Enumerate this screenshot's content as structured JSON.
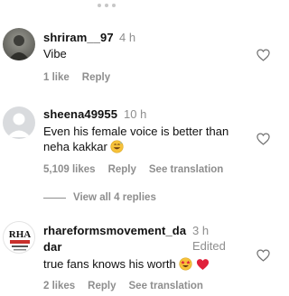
{
  "comments": [
    {
      "username": "shriram__97",
      "time": "4 h",
      "text": "Vibe",
      "likes": "1 like",
      "reply_label": "Reply",
      "avatar_icon": "profile-photo"
    },
    {
      "username": "sheena49955",
      "time": "10 h",
      "text_line1": "Even his female voice is better than",
      "text_line2": "neha kakkar",
      "text_emoji": "grinning-sweat-emoji",
      "likes": "5,109 likes",
      "reply_label": "Reply",
      "translation_label": "See translation",
      "avatar_icon": "default-avatar",
      "view_replies": "View all 4 replies"
    },
    {
      "username_line1": "rhareformsmovement_da",
      "username_line2": "dar",
      "time": "3 h",
      "edited": "Edited",
      "text": "true fans knows his worth",
      "text_emojis": [
        "star-struck-emoji",
        "red-heart-emoji"
      ],
      "likes": "2 likes",
      "reply_label": "Reply",
      "translation_label": "See translation",
      "avatar_logo_text": "RHA",
      "avatar_icon": "rha-logo"
    }
  ],
  "colors": {
    "secondary_text": "#8e8e8e",
    "heart_red": "#e0203a",
    "emoji_yellow": "#f7c23a"
  }
}
